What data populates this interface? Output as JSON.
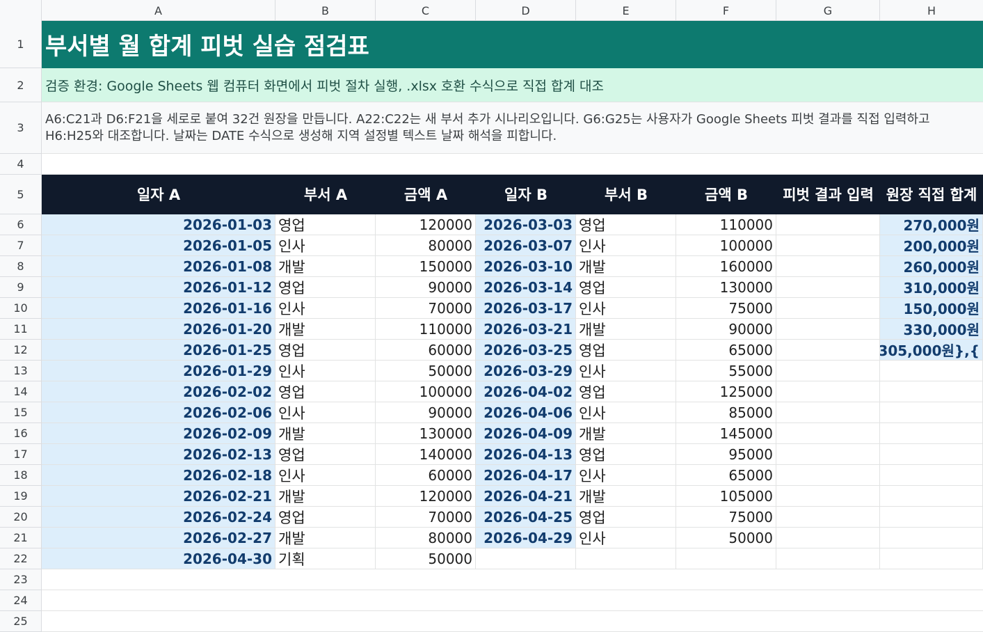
{
  "columns": [
    "A",
    "B",
    "C",
    "D",
    "E",
    "F",
    "G",
    "H"
  ],
  "row_numbers": [
    "1",
    "2",
    "3",
    "4",
    "5",
    "6",
    "7",
    "8",
    "9",
    "10",
    "11",
    "12",
    "13",
    "14",
    "15",
    "16",
    "17",
    "18",
    "19",
    "20",
    "21",
    "22",
    "23",
    "24",
    "25"
  ],
  "title": "부서별 월 합계 피벗 실습 점검표",
  "environment": "검증 환경: Google Sheets 웹 컴퓨터 화면에서 피벗 절차 실행, .xlsx 호환 수식으로 직접 합계 대조",
  "note": "A6:C21과 D6:F21을 세로로 붙여 32건 원장을 만듭니다. A22:C22는 새 부서 추가 시나리오입니다. G6:G25는 사용자가 Google Sheets 피벗 결과를 직접 입력하고 H6:H25와 대조합니다. 날짜는 DATE 수식으로 생성해 지역 설정별 텍스트 날짜 해석을 피합니다.",
  "headers": [
    "일자 A",
    "부서 A",
    "금액 A",
    "일자 B",
    "부서 B",
    "금액 B",
    "피벗 결과 입력",
    "원장 직접 합계"
  ],
  "rows": [
    {
      "date_a": "2026-01-03",
      "dept_a": "영업",
      "amt_a": "120000",
      "date_b": "2026-03-03",
      "dept_b": "영업",
      "amt_b": "110000",
      "pivot": "",
      "total": "270,000원"
    },
    {
      "date_a": "2026-01-05",
      "dept_a": "인사",
      "amt_a": "80000",
      "date_b": "2026-03-07",
      "dept_b": "인사",
      "amt_b": "100000",
      "pivot": "",
      "total": "200,000원"
    },
    {
      "date_a": "2026-01-08",
      "dept_a": "개발",
      "amt_a": "150000",
      "date_b": "2026-03-10",
      "dept_b": "개발",
      "amt_b": "160000",
      "pivot": "",
      "total": "260,000원"
    },
    {
      "date_a": "2026-01-12",
      "dept_a": "영업",
      "amt_a": "90000",
      "date_b": "2026-03-14",
      "dept_b": "영업",
      "amt_b": "130000",
      "pivot": "",
      "total": "310,000원"
    },
    {
      "date_a": "2026-01-16",
      "dept_a": "인사",
      "amt_a": "70000",
      "date_b": "2026-03-17",
      "dept_b": "인사",
      "amt_b": "75000",
      "pivot": "",
      "total": "150,000원"
    },
    {
      "date_a": "2026-01-20",
      "dept_a": "개발",
      "amt_a": "110000",
      "date_b": "2026-03-21",
      "dept_b": "개발",
      "amt_b": "90000",
      "pivot": "",
      "total": "330,000원"
    },
    {
      "date_a": "2026-01-25",
      "dept_a": "영업",
      "amt_a": "60000",
      "date_b": "2026-03-25",
      "dept_b": "영업",
      "amt_b": "65000",
      "pivot": "",
      "total": "305,000원},{"
    },
    {
      "date_a": "2026-01-29",
      "dept_a": "인사",
      "amt_a": "50000",
      "date_b": "2026-03-29",
      "dept_b": "인사",
      "amt_b": "55000",
      "pivot": "",
      "total": ""
    },
    {
      "date_a": "2026-02-02",
      "dept_a": "영업",
      "amt_a": "100000",
      "date_b": "2026-04-02",
      "dept_b": "영업",
      "amt_b": "125000",
      "pivot": "",
      "total": ""
    },
    {
      "date_a": "2026-02-06",
      "dept_a": "인사",
      "amt_a": "90000",
      "date_b": "2026-04-06",
      "dept_b": "인사",
      "amt_b": "85000",
      "pivot": "",
      "total": ""
    },
    {
      "date_a": "2026-02-09",
      "dept_a": "개발",
      "amt_a": "130000",
      "date_b": "2026-04-09",
      "dept_b": "개발",
      "amt_b": "145000",
      "pivot": "",
      "total": ""
    },
    {
      "date_a": "2026-02-13",
      "dept_a": "영업",
      "amt_a": "140000",
      "date_b": "2026-04-13",
      "dept_b": "영업",
      "amt_b": "95000",
      "pivot": "",
      "total": ""
    },
    {
      "date_a": "2026-02-18",
      "dept_a": "인사",
      "amt_a": "60000",
      "date_b": "2026-04-17",
      "dept_b": "인사",
      "amt_b": "65000",
      "pivot": "",
      "total": ""
    },
    {
      "date_a": "2026-02-21",
      "dept_a": "개발",
      "amt_a": "120000",
      "date_b": "2026-04-21",
      "dept_b": "개발",
      "amt_b": "105000",
      "pivot": "",
      "total": ""
    },
    {
      "date_a": "2026-02-24",
      "dept_a": "영업",
      "amt_a": "70000",
      "date_b": "2026-04-25",
      "dept_b": "영업",
      "amt_b": "75000",
      "pivot": "",
      "total": ""
    },
    {
      "date_a": "2026-02-27",
      "dept_a": "개발",
      "amt_a": "80000",
      "date_b": "2026-04-29",
      "dept_b": "인사",
      "amt_b": "50000",
      "pivot": "",
      "total": ""
    },
    {
      "date_a": "2026-04-30",
      "dept_a": "기획",
      "amt_a": "50000",
      "date_b": "",
      "dept_b": "",
      "amt_b": "",
      "pivot": "",
      "total": ""
    }
  ]
}
